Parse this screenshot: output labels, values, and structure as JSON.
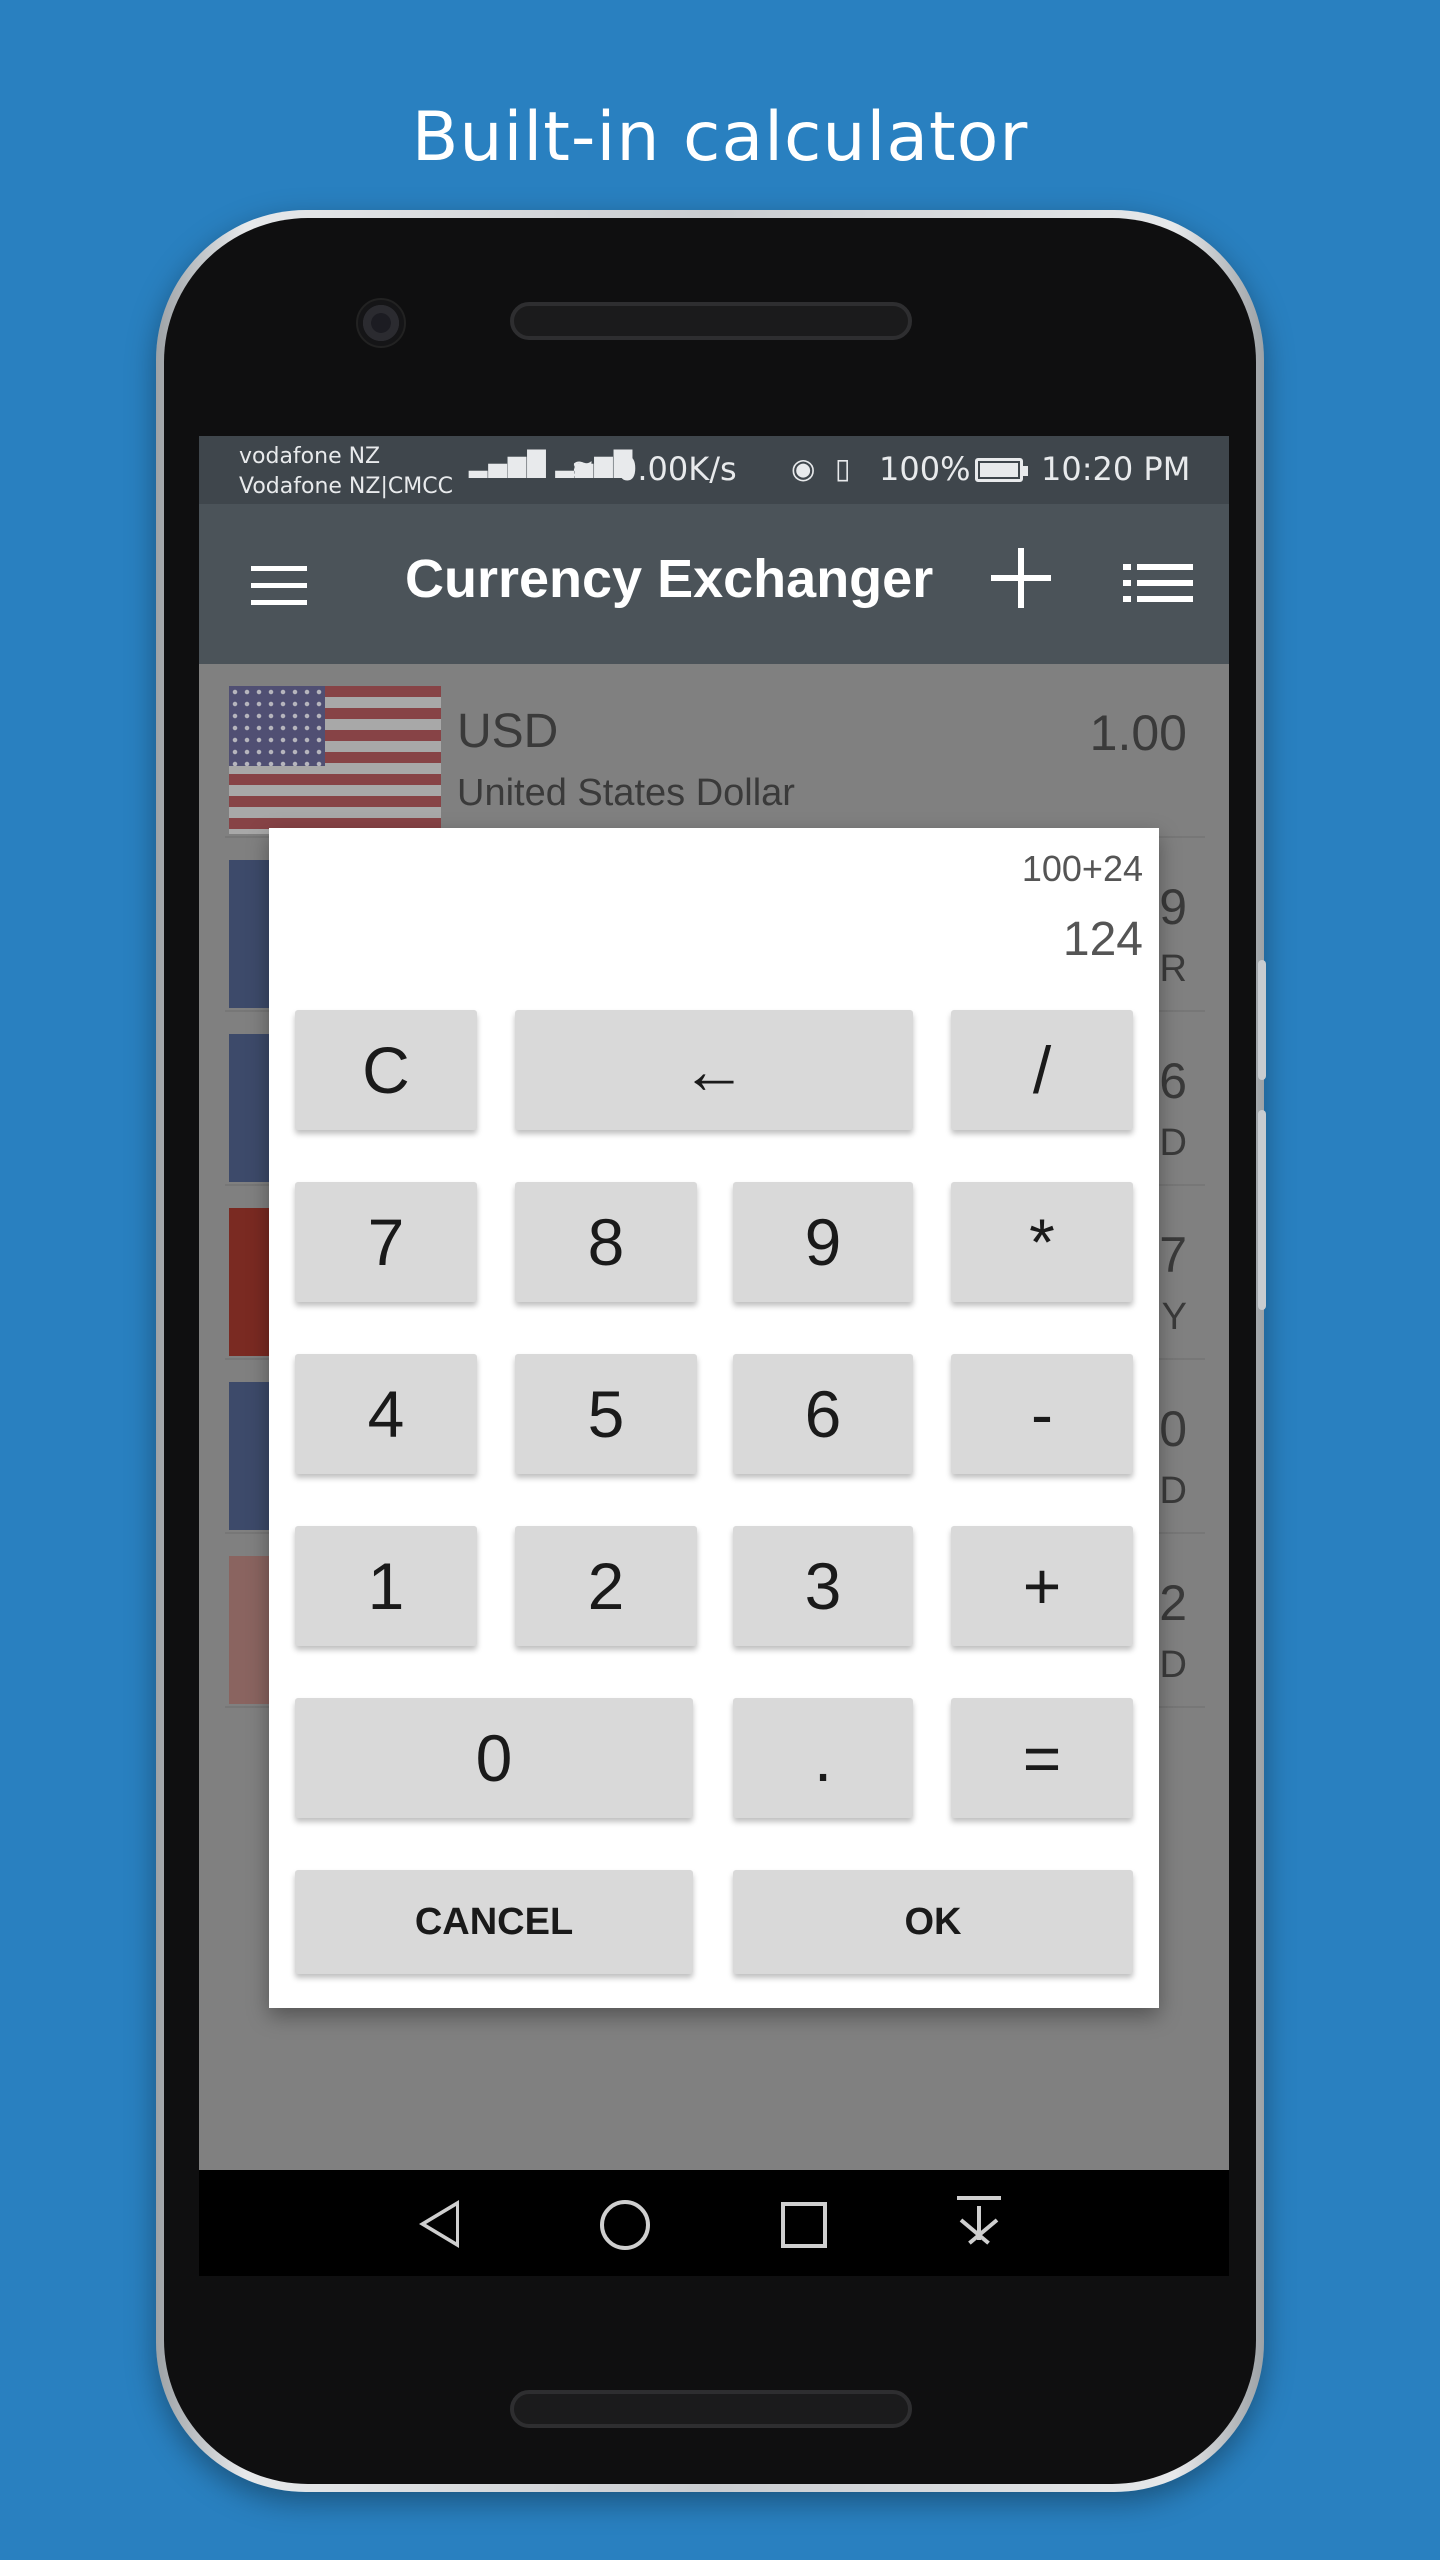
{
  "headline": "Built-in calculator",
  "status_bar": {
    "carrier_1": "vodafone NZ",
    "carrier_2": "Vodafone NZ|CMCC",
    "network_icons": "4G 4G R",
    "speed": "0.00K/s",
    "battery": "100%",
    "time": "10:20 PM"
  },
  "app_bar": {
    "title": "Currency Exchanger"
  },
  "currencies": [
    {
      "code": "USD",
      "name": "United States Dollar",
      "value": "1.00",
      "flag": "us-flag"
    },
    {
      "value_tail": "9",
      "code_tail": "R",
      "flag": "blue-flag"
    },
    {
      "value_tail": "6",
      "code_tail": "D",
      "flag": "uk-union-flag"
    },
    {
      "value_tail": "7",
      "code_tail": "Y",
      "flag": "china-flag"
    },
    {
      "value_tail": "0",
      "code_tail": "D",
      "flag": "uk-union-flag"
    },
    {
      "value_tail": "2",
      "code_tail": "D",
      "flag": "red-flag"
    }
  ],
  "calculator": {
    "expression": "100+24",
    "result": "124",
    "keys": {
      "clear": "C",
      "backspace": "←",
      "divide": "/",
      "seven": "7",
      "eight": "8",
      "nine": "9",
      "multiply": "*",
      "four": "4",
      "five": "5",
      "six": "6",
      "minus": "-",
      "one": "1",
      "two": "2",
      "three": "3",
      "plus": "+",
      "zero": "0",
      "dot": ".",
      "equals": "="
    },
    "cancel_label": "CANCEL",
    "ok_label": "OK"
  }
}
